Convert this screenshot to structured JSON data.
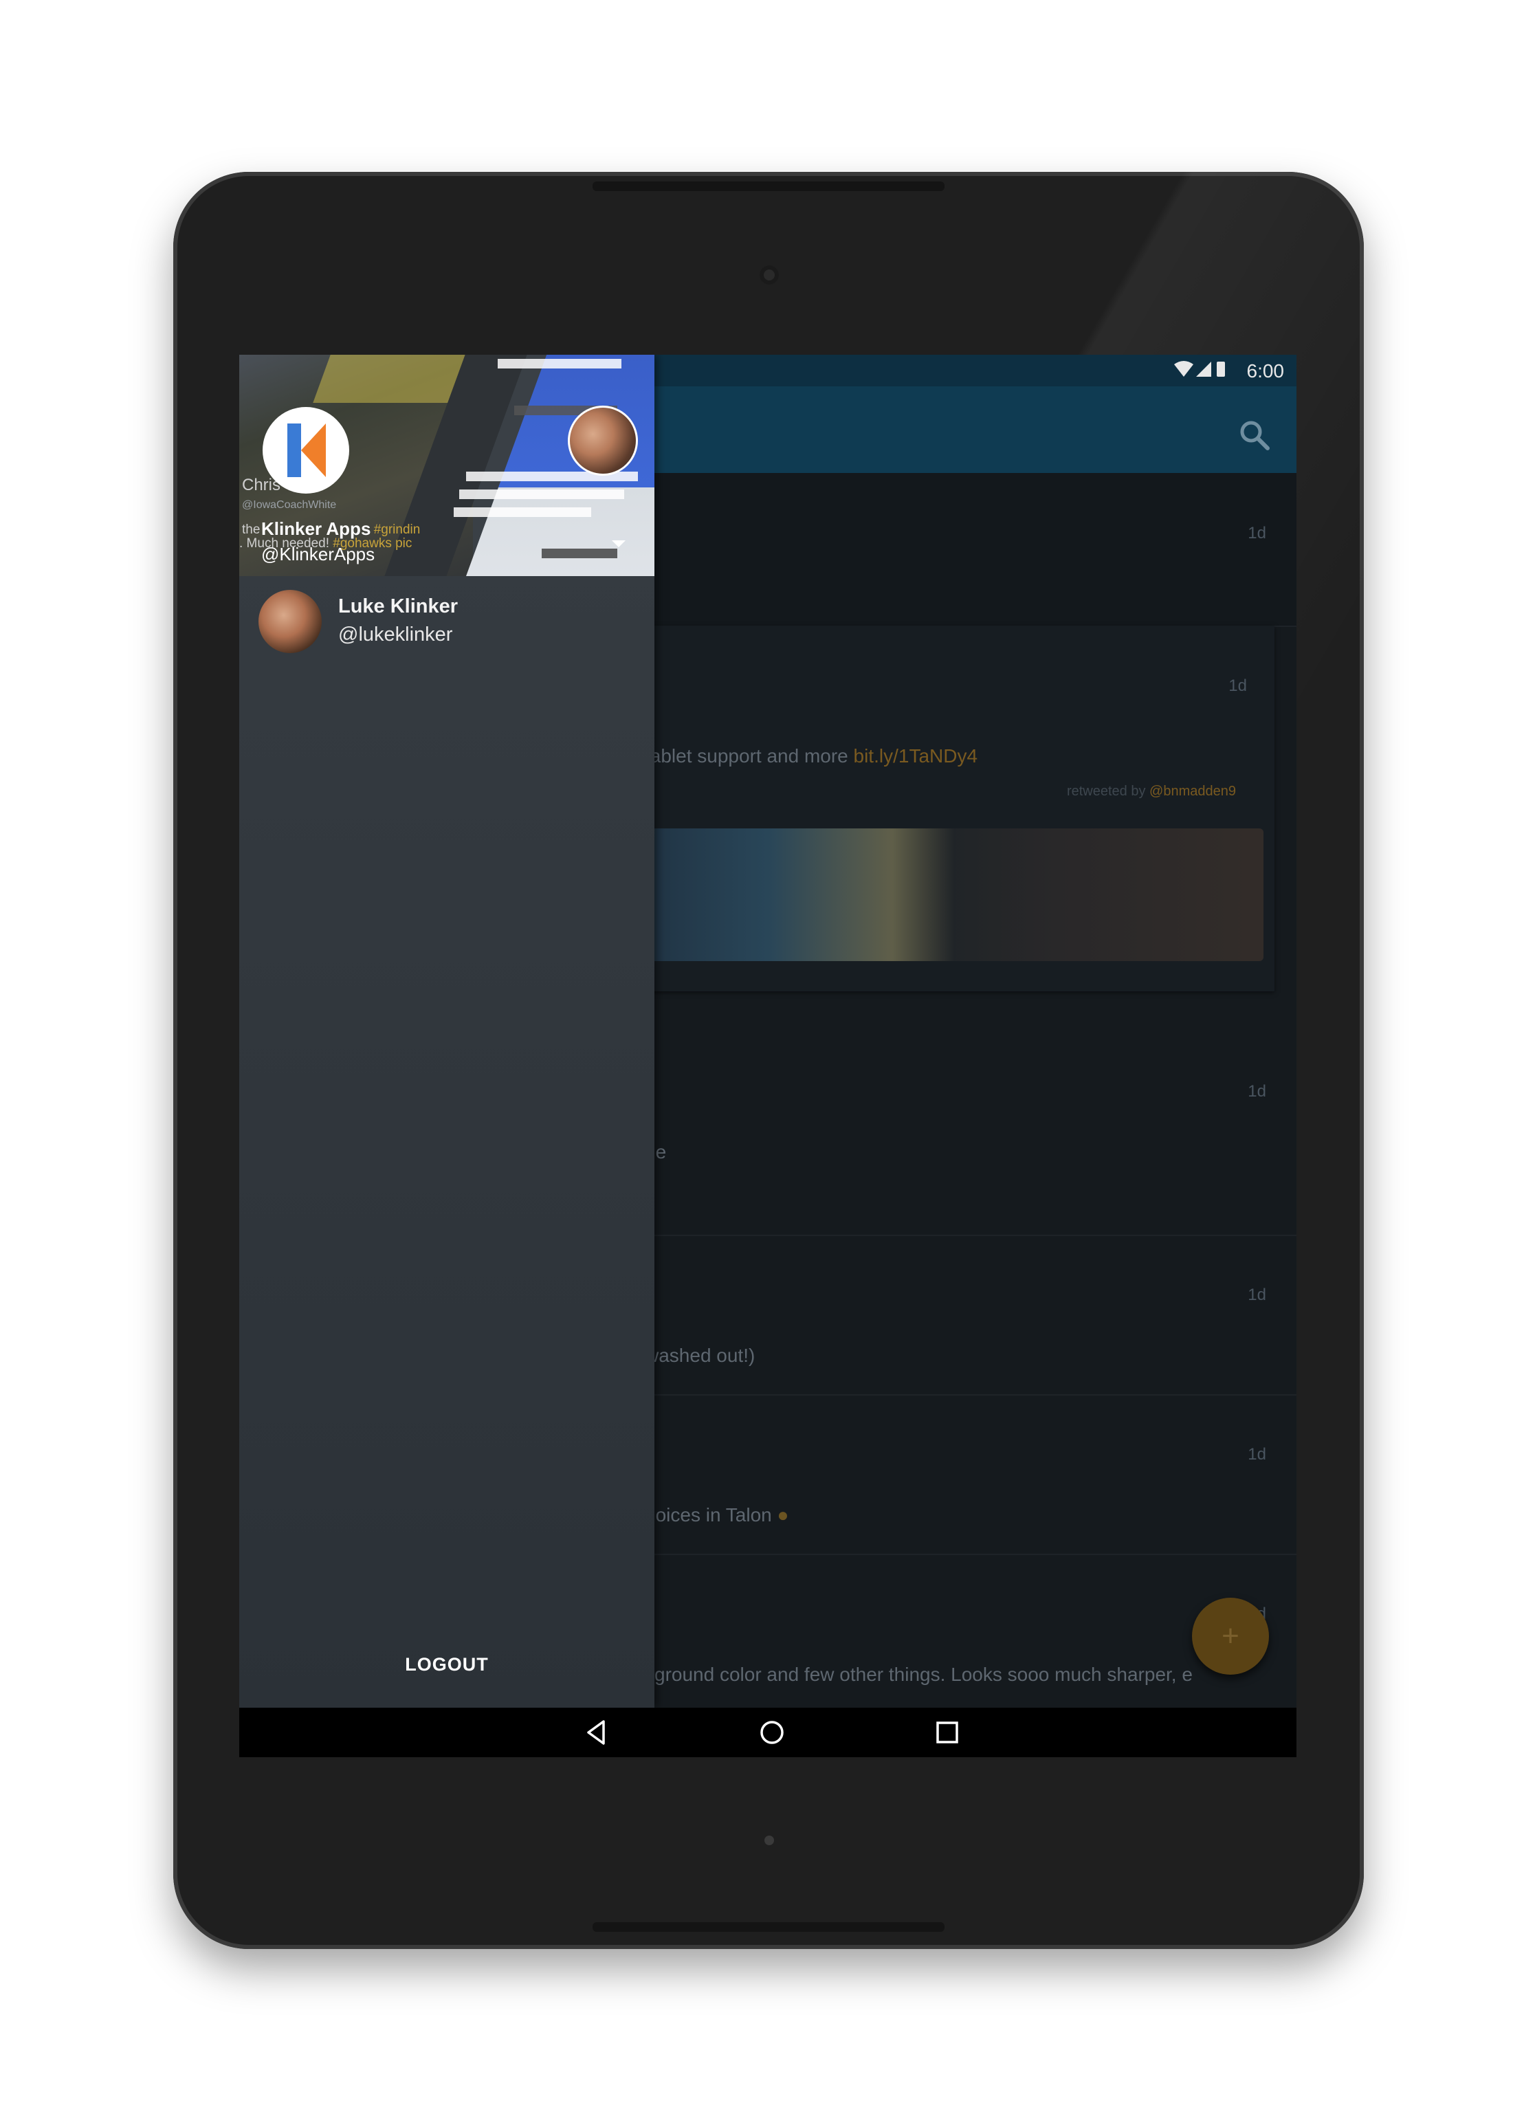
{
  "status_bar": {
    "time": "6:00",
    "icons": [
      "wifi-icon",
      "signal-icon",
      "battery-icon"
    ]
  },
  "drawer": {
    "header": {
      "bg_name_partial": "Chris",
      "bg_handle_partial": "@IowaCoachWhite",
      "bg_text_1": "the",
      "bg_text_hashtag_1": "#grindin",
      "bg_text_2": ". Much needed!",
      "bg_text_hashtag_2": "#gohawks pic",
      "account_name": "Klinker Apps",
      "account_handle": "@KlinkerApps"
    },
    "secondary_account": {
      "name": "Luke Klinker",
      "handle": "@lukeklinker"
    },
    "logout_label": "LOGOUT"
  },
  "timeline": {
    "tweets": [
      {
        "time": "1d",
        "text": ""
      },
      {
        "time": "1d",
        "text": "tablet support and more ",
        "link": "bit.ly/1TaNDy4",
        "retweeted_prefix": "retweeted by ",
        "retweeted_by": "@bnmadden9"
      },
      {
        "time": "1d",
        "text": "ne"
      },
      {
        "time": "1d",
        "text": "washed out!)"
      },
      {
        "time": "1d",
        "text": "hoices in Talon"
      },
      {
        "time": "1d",
        "text": "kground color and few other things. Looks sooo much sharper, e"
      }
    ]
  },
  "fab": {
    "icon": "plus-icon",
    "label": "+"
  },
  "colors": {
    "toolbar": "#0f3b52",
    "drawer": "#2f353b",
    "accent": "#b5821f"
  }
}
